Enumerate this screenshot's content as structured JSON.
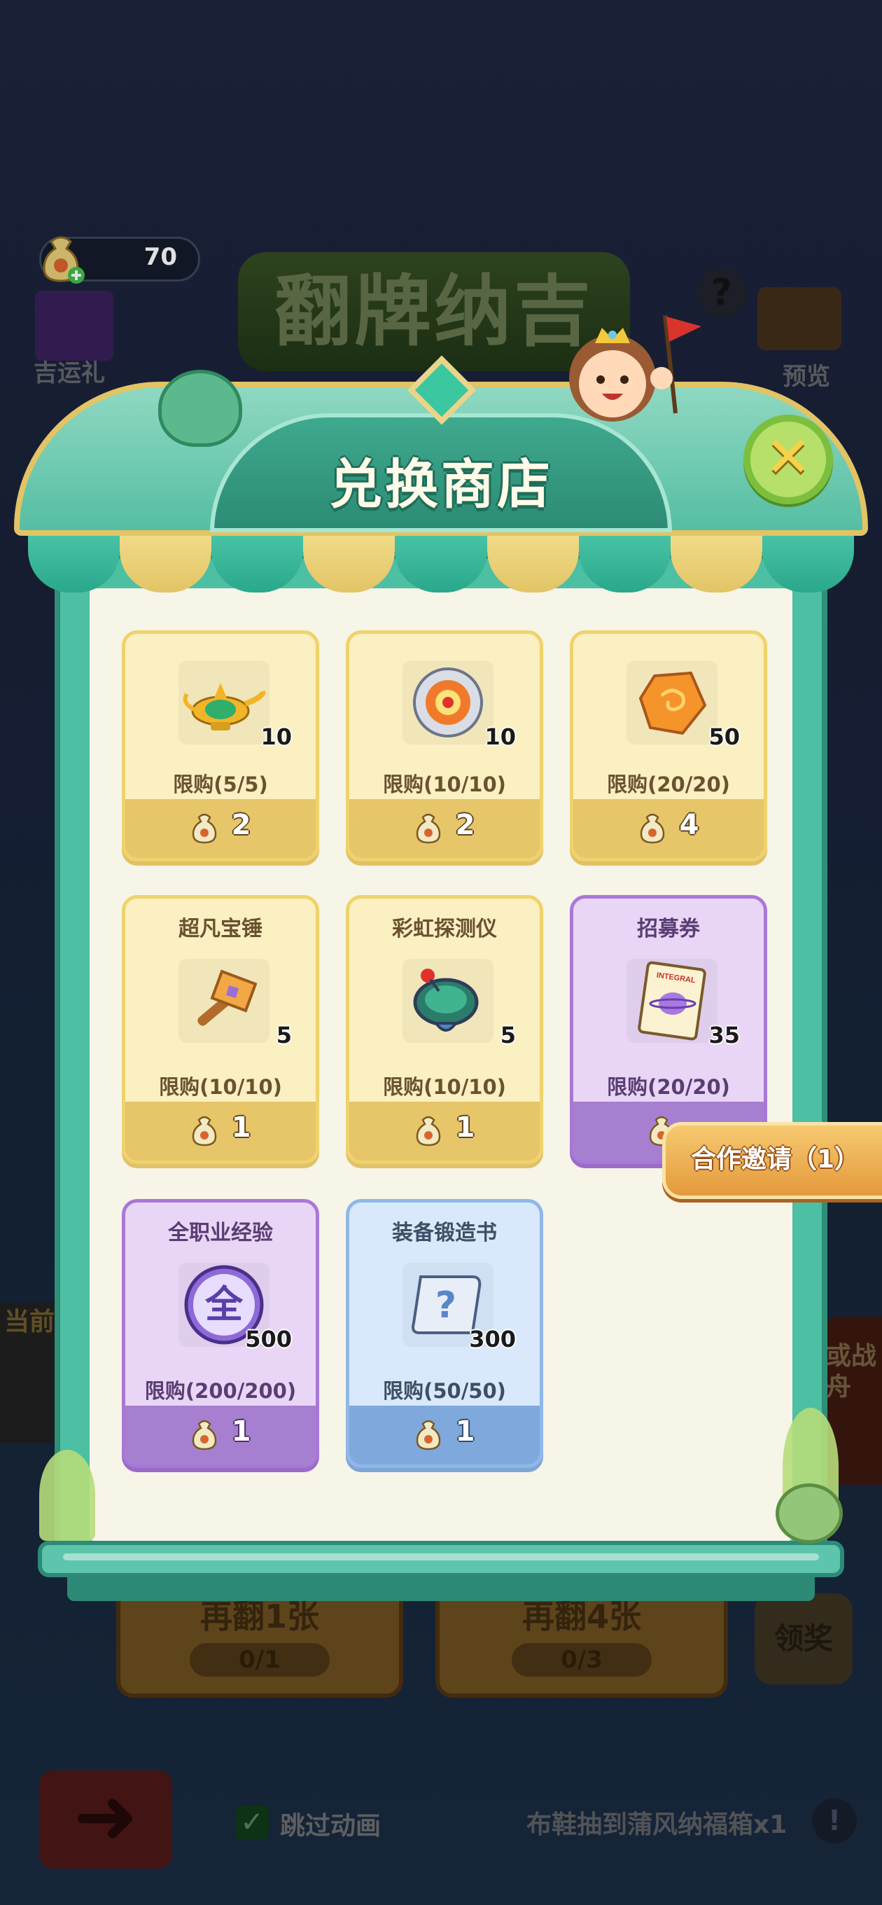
{
  "currency": {
    "amount": "70",
    "icon": "money-bag-icon"
  },
  "background": {
    "event_title": "翻牌纳吉",
    "gift_label": "吉运礼",
    "preview_label": "预览",
    "flip_one": {
      "title": "再翻1张",
      "progress": "0/1"
    },
    "flip_four": {
      "title": "再翻4张",
      "progress": "0/3"
    },
    "claim_label": "领奖",
    "skip_animation_label": "跳过动画",
    "skip_animation_checked": true,
    "status_note": "布鞋抽到蒲风纳福箱x1",
    "left_side_label": "当前",
    "right_side_label": "或战舟"
  },
  "shop": {
    "title": "兑换商店",
    "close_icon": "close-icon",
    "items": [
      {
        "name": "",
        "icon": "magic-lamp-icon",
        "qty": "10",
        "limit": "限购(5/5)",
        "price": "2",
        "rarity": "yellow"
      },
      {
        "name": "",
        "icon": "compass-disc-icon",
        "qty": "10",
        "limit": "限购(10/10)",
        "price": "2",
        "rarity": "yellow"
      },
      {
        "name": "",
        "icon": "orange-crystal-icon",
        "qty": "50",
        "limit": "限购(20/20)",
        "price": "4",
        "rarity": "yellow"
      },
      {
        "name": "超凡宝锤",
        "icon": "hammer-icon",
        "qty": "5",
        "limit": "限购(10/10)",
        "price": "1",
        "rarity": "yellow"
      },
      {
        "name": "彩虹探测仪",
        "icon": "detector-icon",
        "qty": "5",
        "limit": "限购(10/10)",
        "price": "1",
        "rarity": "yellow"
      },
      {
        "name": "招募券",
        "icon": "ticket-icon",
        "qty": "35",
        "limit": "限购(20/20)",
        "price": "",
        "rarity": "purple"
      },
      {
        "name": "全职业经验",
        "icon": "exp-orb-icon",
        "qty": "500",
        "limit": "限购(200/200)",
        "price": "1",
        "rarity": "purple"
      },
      {
        "name": "装备锻造书",
        "icon": "scroll-icon",
        "qty": "300",
        "limit": "限购(50/50)",
        "price": "1",
        "rarity": "blue"
      }
    ],
    "exp_orb_char": "全",
    "scroll_char": "?",
    "ticket_text": "INTEGRAL"
  },
  "invite": {
    "label": "合作邀请（1）"
  },
  "colors": {
    "frame": "#4dbfa3",
    "card_yellow": "#fbf0c2",
    "card_purple": "#e9d6f6",
    "card_blue": "#d9e9fb"
  }
}
